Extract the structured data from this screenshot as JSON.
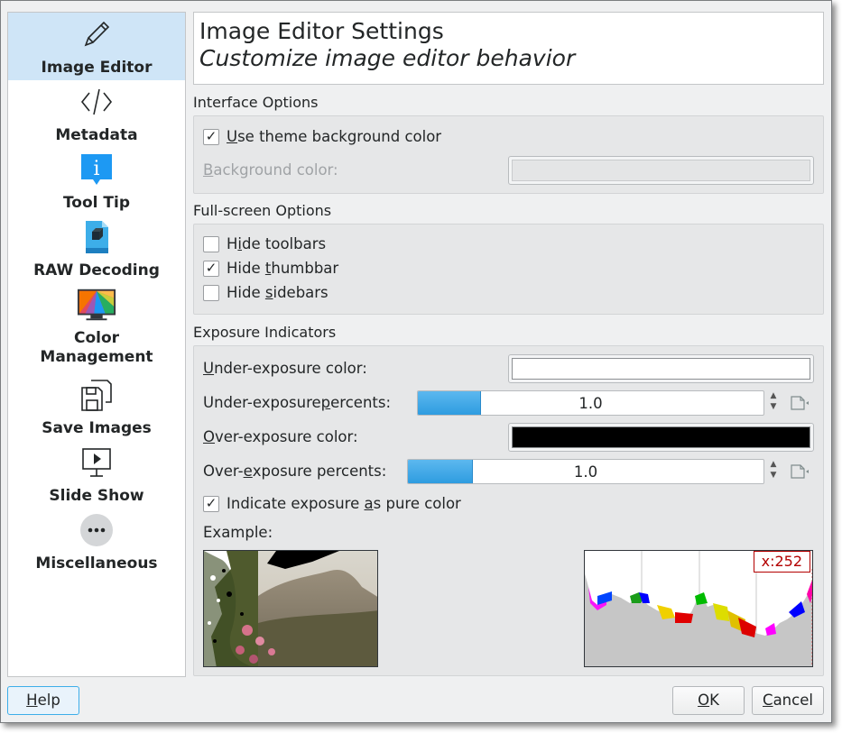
{
  "sidebar": {
    "items": [
      {
        "label": "Image Editor",
        "icon": "pencil-icon"
      },
      {
        "label": "Metadata",
        "icon": "code-icon"
      },
      {
        "label": "Tool Tip",
        "icon": "info-icon"
      },
      {
        "label": "RAW Decoding",
        "icon": "raw-file-icon"
      },
      {
        "label": "Color",
        "label2": "Management",
        "icon": "monitor-color-icon"
      },
      {
        "label": "Save Images",
        "icon": "save-images-icon"
      },
      {
        "label": "Slide Show",
        "icon": "slideshow-icon"
      },
      {
        "label": "Miscellaneous",
        "icon": "more-icon"
      }
    ]
  },
  "header": {
    "title": "Image Editor Settings",
    "subtitle": "Customize image editor behavior"
  },
  "interface": {
    "title": "Interface Options",
    "use_theme_bg_pre": "",
    "use_theme_bg_u": "U",
    "use_theme_bg_post": "se theme background color",
    "use_theme_bg_checked": true,
    "bg_color_u": "B",
    "bg_color_post": "ackground color:"
  },
  "fullscreen": {
    "title": "Full-screen Options",
    "hide_toolbars_pre": "H",
    "hide_toolbars_u": "i",
    "hide_toolbars_post": "de toolbars",
    "hide_thumbbar_pre": "Hide ",
    "hide_thumbbar_u": "t",
    "hide_thumbbar_post": "humbbar",
    "hide_sidebars_pre": "Hide ",
    "hide_sidebars_u": "s",
    "hide_sidebars_post": "idebars"
  },
  "exposure": {
    "title": "Exposure Indicators",
    "under_color_pre": "",
    "under_color_u": "U",
    "under_color_post": "nder-exposure color:",
    "under_color_value": "#ffffff",
    "under_pct_pre": "Under-exposure ",
    "under_pct_u": "p",
    "under_pct_post": "ercents:",
    "under_pct_value": "1.0",
    "over_color_pre": "",
    "over_color_u": "O",
    "over_color_post": "ver-exposure color:",
    "over_color_value": "#000000",
    "over_pct_pre": "Over-",
    "over_pct_u": "e",
    "over_pct_post": "xposure percents:",
    "over_pct_value": "1.0",
    "indicate_pre": "Indicate exposure ",
    "indicate_u": "a",
    "indicate_post": "s pure color",
    "example_label": "Example:",
    "histogram_readout": "x:252"
  },
  "buttons": {
    "help_u": "H",
    "help_post": "elp",
    "ok_u": "O",
    "ok_post": "K",
    "cancel_u": "C",
    "cancel_post": "ancel"
  },
  "colors": {
    "accent": "#3daee9",
    "selection": "#cfe5f7"
  }
}
